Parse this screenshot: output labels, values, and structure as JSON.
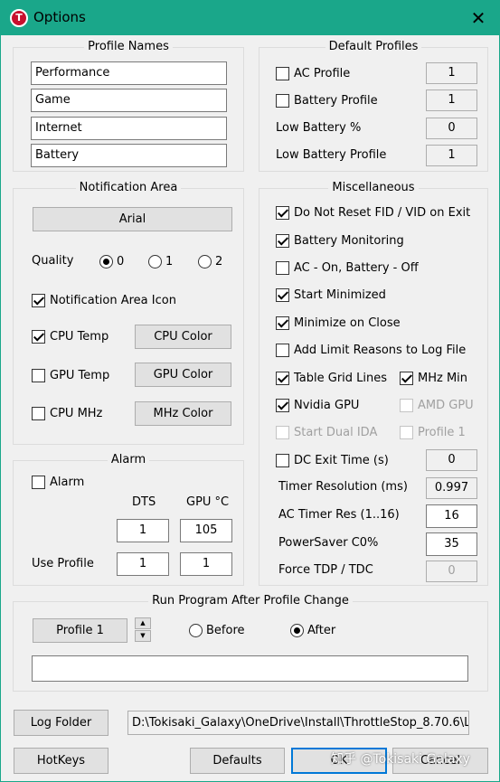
{
  "window": {
    "title": "Options",
    "icon_letter": "T"
  },
  "profile_names": {
    "label": "Profile Names",
    "items": [
      "Performance",
      "Game",
      "Internet",
      "Battery"
    ]
  },
  "default_profiles": {
    "label": "Default Profiles",
    "ac_profile": {
      "label": "AC Profile",
      "checked": false,
      "value": "1"
    },
    "battery_profile": {
      "label": "Battery Profile",
      "checked": false,
      "value": "1"
    },
    "low_battery_pct": {
      "label": "Low Battery %",
      "value": "0"
    },
    "low_battery_profile": {
      "label": "Low Battery Profile",
      "value": "1"
    }
  },
  "notification": {
    "label": "Notification Area",
    "font_button": "Arial",
    "quality_label": "Quality",
    "quality_options": [
      "0",
      "1",
      "2"
    ],
    "icon_check": "Notification Area Icon",
    "cpu_temp": "CPU Temp",
    "gpu_temp": "GPU Temp",
    "cpu_mhz": "CPU MHz",
    "cpu_color": "CPU Color",
    "gpu_color": "GPU Color",
    "mhz_color": "MHz Color"
  },
  "misc": {
    "label": "Miscellaneous",
    "do_not_reset": "Do Not Reset FID / VID on Exit",
    "battery_monitoring": "Battery Monitoring",
    "ac_on_battery_off": "AC - On, Battery - Off",
    "start_minimized": "Start Minimized",
    "minimize_on_close": "Minimize on Close",
    "add_limit_reasons": "Add Limit Reasons to Log File",
    "table_grid_lines": "Table Grid Lines",
    "mhz_min": "MHz Min",
    "nvidia_gpu": "Nvidia GPU",
    "amd_gpu": "AMD GPU",
    "start_dual_ida": "Start Dual IDA",
    "profile_1": "Profile 1",
    "dc_exit_time": {
      "label": "DC Exit Time (s)",
      "value": "0"
    },
    "timer_resolution": {
      "label": "Timer Resolution (ms)",
      "value": "0.997"
    },
    "ac_timer_res": {
      "label": "AC Timer Res (1..16)",
      "value": "16"
    },
    "powersaver_c0": {
      "label": "PowerSaver C0%",
      "value": "35"
    },
    "force_tdp": {
      "label": "Force TDP / TDC",
      "value": "0"
    }
  },
  "alarm": {
    "label": "Alarm",
    "check": "Alarm",
    "dts_header": "DTS",
    "gpu_header": "GPU °C",
    "dts_value": "1",
    "gpu_value": "105",
    "use_profile_label": "Use Profile",
    "use_profile_dts": "1",
    "use_profile_gpu": "1"
  },
  "run_program": {
    "label": "Run Program After Profile Change",
    "profile_button": "Profile 1",
    "before": "Before",
    "after": "After",
    "path": ""
  },
  "log_folder": {
    "button": "Log Folder",
    "path": "D:\\Tokisaki_Galaxy\\OneDrive\\Install\\ThrottleStop_8.70.6\\L"
  },
  "footer": {
    "hotkeys": "HotKeys",
    "defaults": "Defaults",
    "ok": "OK",
    "cancel": "Cancel"
  },
  "watermark": "知乎 @Tokisaki Galaxy",
  "colors": {
    "titlebar": "#1aa78a",
    "focus": "#0078d7"
  }
}
